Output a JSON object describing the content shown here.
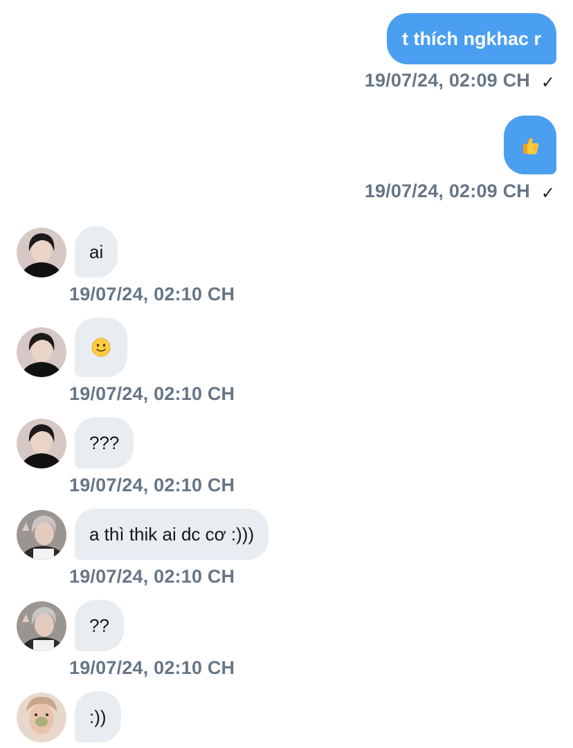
{
  "messages": [
    {
      "text": "t thích ngkhac r",
      "timestamp": "19/07/24, 02:09 CH",
      "status_icon": "✓"
    },
    {
      "emoji": "thumbs-up-emoji",
      "timestamp": "19/07/24, 02:09 CH",
      "status_icon": "✓"
    },
    {
      "text": "ai",
      "timestamp": "19/07/24, 02:10 CH"
    },
    {
      "emoji": "slight-smile-emoji",
      "timestamp": "19/07/24, 02:10 CH"
    },
    {
      "text": "???",
      "timestamp": "19/07/24, 02:10 CH"
    },
    {
      "text": "a thì thik ai dc cơ :)))",
      "timestamp": "19/07/24, 02:10 CH"
    },
    {
      "text": "??",
      "timestamp": "19/07/24, 02:10 CH"
    },
    {
      "text": ":))"
    }
  ],
  "colors": {
    "outgoing_bubble": "#4a9ff0",
    "incoming_bubble": "#e8edf2",
    "timestamp": "#667686"
  }
}
